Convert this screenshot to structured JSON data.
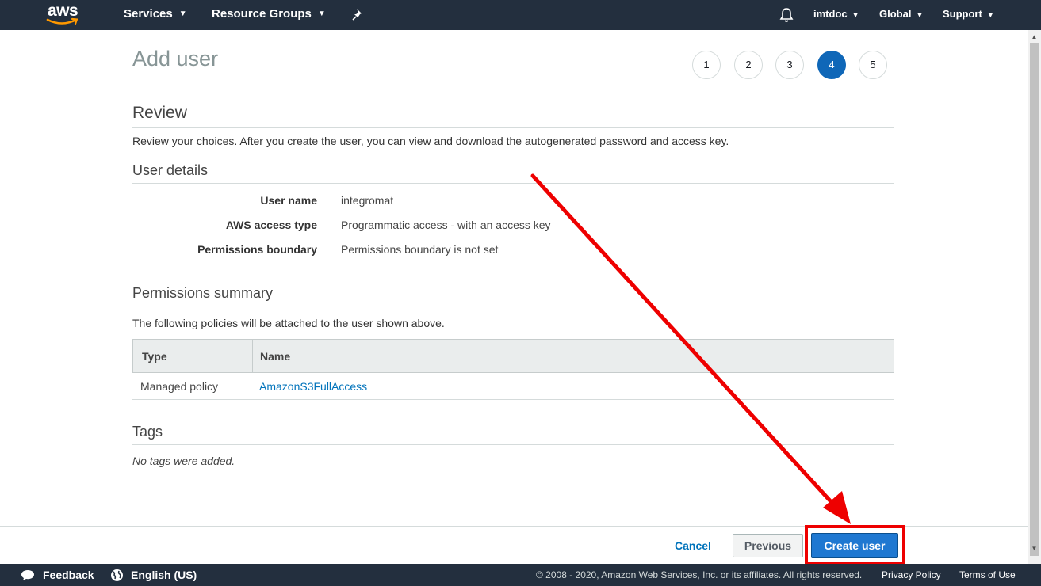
{
  "topnav": {
    "logo_text": "aws",
    "services": "Services",
    "resource_groups": "Resource Groups",
    "account": "imtdoc",
    "region": "Global",
    "support": "Support"
  },
  "page": {
    "title": "Add user",
    "steps": [
      "1",
      "2",
      "3",
      "4",
      "5"
    ],
    "active_step": "4"
  },
  "review": {
    "heading": "Review",
    "description": "Review your choices. After you create the user, you can view and download the autogenerated password and access key."
  },
  "user_details": {
    "heading": "User details",
    "rows": [
      {
        "label": "User name",
        "value": "integromat"
      },
      {
        "label": "AWS access type",
        "value": "Programmatic access - with an access key"
      },
      {
        "label": "Permissions boundary",
        "value": "Permissions boundary is not set"
      }
    ]
  },
  "permissions": {
    "heading": "Permissions summary",
    "description": "The following policies will be attached to the user shown above.",
    "columns": [
      "Type",
      "Name"
    ],
    "rows": [
      {
        "type": "Managed policy",
        "name": "AmazonS3FullAccess"
      }
    ]
  },
  "tags": {
    "heading": "Tags",
    "empty": "No tags were added."
  },
  "actions": {
    "cancel": "Cancel",
    "previous": "Previous",
    "create": "Create user"
  },
  "footer": {
    "feedback": "Feedback",
    "language": "English (US)",
    "copyright": "© 2008 - 2020, Amazon Web Services, Inc. or its affiliates. All rights reserved.",
    "privacy": "Privacy Policy",
    "terms": "Terms of Use"
  },
  "colors": {
    "nav_bg": "#232f3e",
    "active_step": "#0f67b8",
    "primary_button": "#1f78d1",
    "link": "#0073bb",
    "annotation": "#ee0000"
  }
}
